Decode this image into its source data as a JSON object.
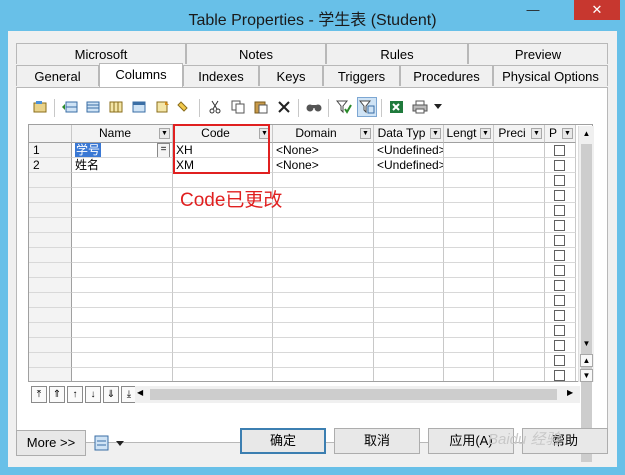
{
  "window": {
    "title": "Table Properties - 学生表 (Student)",
    "minimize_label": "—",
    "close_label": "✕"
  },
  "tabs": {
    "row1": [
      "Microsoft",
      "Notes",
      "Rules",
      "Preview"
    ],
    "row2": [
      "General",
      "Columns",
      "Indexes",
      "Keys",
      "Triggers",
      "Procedures",
      "Physical Options"
    ],
    "active": "Columns"
  },
  "toolbar": {
    "icons": [
      "properties-icon",
      "insert-row-icon",
      "add-row-icon",
      "add-columns-icon",
      "add-table-icon",
      "domain-icon",
      "clear-icon",
      "cut-icon",
      "copy-icon",
      "paste-icon",
      "delete-icon",
      "find-icon",
      "filter-icon",
      "customize-columns-icon",
      "excel-export-icon",
      "print-icon",
      "dropdown-arrow-icon"
    ]
  },
  "grid": {
    "columns": [
      "Name",
      "Code",
      "Domain",
      "Data Typ",
      "Lengt",
      "Preci",
      "P"
    ],
    "rows": [
      {
        "num": "1",
        "name": "学号",
        "code": "XH",
        "domain": "<None>",
        "datatype": "<Undefined>",
        "eq": "="
      },
      {
        "num": "2",
        "name": "姓名",
        "code": "XM",
        "domain": "<None>",
        "datatype": "<Undefined>"
      }
    ]
  },
  "annotation": {
    "text": "Code已更改",
    "color": "#e02020"
  },
  "footer": {
    "more_label": "More >>",
    "ok_label": "确定",
    "cancel_label": "取消",
    "apply_label": "应用(A)",
    "help_label": "帮助"
  },
  "watermark": "Baidu 经验"
}
